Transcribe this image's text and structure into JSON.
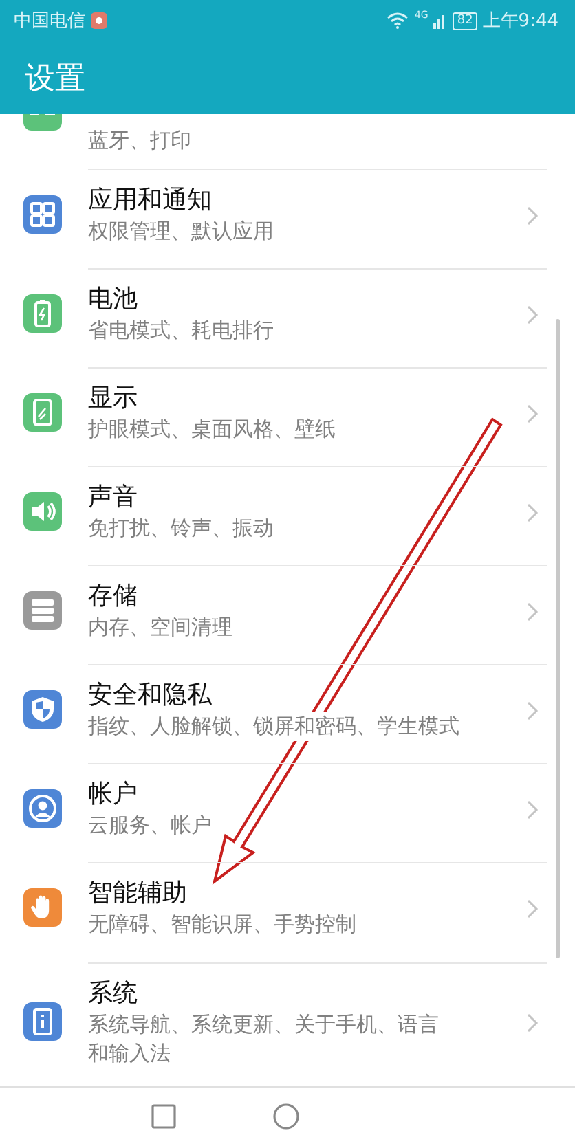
{
  "status_bar": {
    "carrier": "中国电信",
    "network": "4G",
    "battery": "82",
    "time": "上午9:44"
  },
  "title": "设置",
  "items": [
    {
      "kind": "partial",
      "subtitle": "蓝牙、打印",
      "color": "#5cc27a"
    },
    {
      "kind": "full",
      "title": "应用和通知",
      "subtitle": "权限管理、默认应用",
      "color": "#4f86d6"
    },
    {
      "kind": "full",
      "title": "电池",
      "subtitle": "省电模式、耗电排行",
      "color": "#5cc27a"
    },
    {
      "kind": "full",
      "title": "显示",
      "subtitle": "护眼模式、桌面风格、壁纸",
      "color": "#5cc27a"
    },
    {
      "kind": "full",
      "title": "声音",
      "subtitle": "免打扰、铃声、振动",
      "color": "#5cc27a"
    },
    {
      "kind": "full",
      "title": "存储",
      "subtitle": "内存、空间清理",
      "color": "#9a9a9a"
    },
    {
      "kind": "full",
      "title": "安全和隐私",
      "subtitle": "指纹、人脸解锁、锁屏和密码、学生模式",
      "color": "#4f86d6"
    },
    {
      "kind": "full",
      "title": "帐户",
      "subtitle": "云服务、帐户",
      "color": "#4f86d6"
    },
    {
      "kind": "full",
      "title": "智能辅助",
      "subtitle": "无障碍、智能识屏、手势控制",
      "color": "#ef8a3a"
    },
    {
      "kind": "full",
      "title": "系统",
      "subtitle": "系统导航、系统更新、关于手机、语言和输入法",
      "color": "#4f86d6"
    }
  ]
}
